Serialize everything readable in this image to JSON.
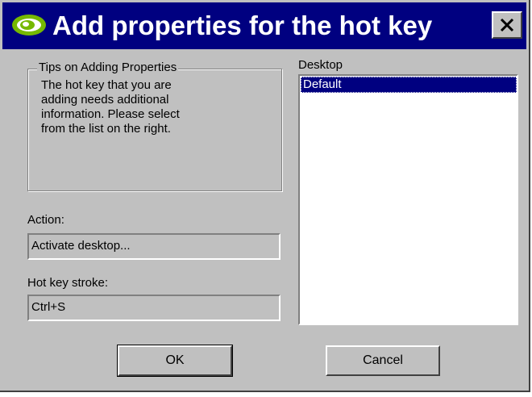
{
  "dialog": {
    "title": "Add properties for the hot key",
    "close_glyph": "✕",
    "logo_icon": "nvidia-eye-icon",
    "close_icon": "close-icon"
  },
  "tips": {
    "legend": "Tips on Adding Properties",
    "lines": [
      "The hot key that you are",
      "adding needs additional",
      "information.  Please select",
      "from the list on the right."
    ]
  },
  "action": {
    "label": "Action:",
    "value": "Activate desktop..."
  },
  "hotkey": {
    "label": "Hot key stroke:",
    "value": "Ctrl+S"
  },
  "desktop": {
    "label": "Desktop",
    "items": [
      "Default"
    ],
    "selected": "Default"
  },
  "buttons": {
    "ok": "OK",
    "cancel": "Cancel"
  },
  "colors": {
    "title_bar": "#000080",
    "face": "#c0c0c0",
    "selection": "#000080",
    "logo_green": "#76b900"
  }
}
